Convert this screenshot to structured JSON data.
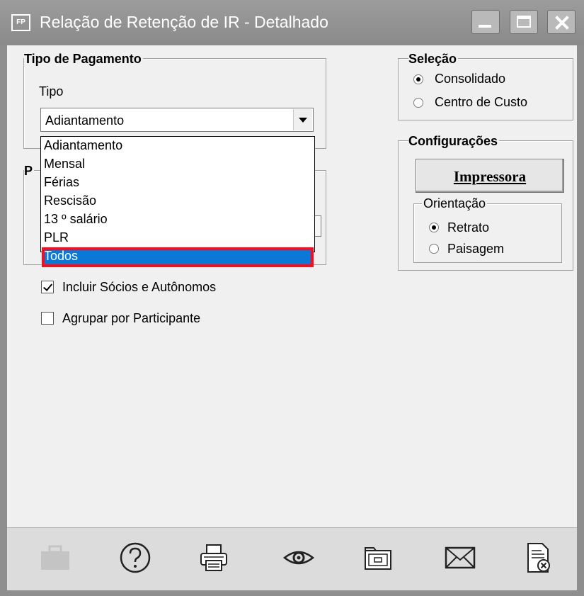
{
  "window": {
    "app_icon": "FP",
    "title": "Relação de Retenção de IR  - Detalhado",
    "controls": [
      "minimize-icon",
      "maximize-icon",
      "close-icon"
    ]
  },
  "tipo_pagamento": {
    "legend": "Tipo de Pagamento",
    "tipo_label": "Tipo",
    "selected_value": "Adiantamento",
    "options": [
      "Adiantamento",
      "Mensal",
      "Férias",
      "Rescisão",
      "13 º salário",
      "PLR",
      "Todos"
    ],
    "highlighted_option": "Todos"
  },
  "hidden_group": {
    "legend_partial": "P"
  },
  "checkboxes": {
    "incluir": {
      "label": "Incluir Sócios e Autônomos",
      "checked": true
    },
    "agrupar": {
      "label": "Agrupar por Participante",
      "checked": false
    }
  },
  "selecao": {
    "legend": "Seleção",
    "options": [
      "Consolidado",
      "Centro de Custo"
    ],
    "selected": "Consolidado"
  },
  "configuracoes": {
    "legend": "Configurações",
    "printer_button": "Impressora",
    "orientacao": {
      "legend": "Orientação",
      "options": [
        "Retrato",
        "Paisagem"
      ],
      "selected": "Retrato"
    }
  },
  "toolbar": {
    "items": [
      "briefcase-icon",
      "help-icon",
      "printer-icon",
      "preview-icon",
      "folder-icon",
      "email-icon",
      "document-close-icon"
    ],
    "disabled": [
      "briefcase-icon"
    ]
  },
  "colors": {
    "titlebar": "#8e8e8e",
    "selection": "#0a78d7",
    "highlight_border": "#ff0a1a"
  }
}
